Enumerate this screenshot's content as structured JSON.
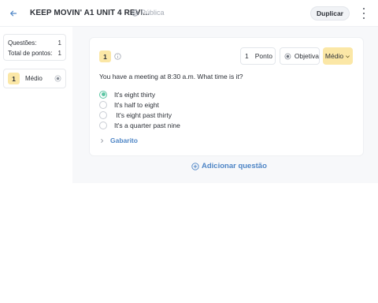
{
  "header": {
    "title": "KEEP MOVIN' A1 UNIT 4 REVI...",
    "visibility": "Pública",
    "duplicate_label": "Duplicar"
  },
  "summary": {
    "questions_label": "Questões:",
    "questions_value": "1",
    "points_label": "Total de pontos:",
    "points_value": "1"
  },
  "sidebar": {
    "question_number": "1",
    "question_difficulty": "Médio"
  },
  "question": {
    "number": "1",
    "points_value": "1",
    "points_label": "Ponto",
    "type_label": "Objetiva",
    "difficulty_label": "Médio",
    "prompt": "You have a meeting at 8:30 a.m. What time is it?",
    "options": [
      {
        "text": "It's eight thirty",
        "selected": true
      },
      {
        "text": "It's half to eight",
        "selected": false
      },
      {
        "text": " It's eight past thirty",
        "selected": false
      },
      {
        "text": "It's a quarter past nine",
        "selected": false
      }
    ],
    "answer_key_label": "Gabarito"
  },
  "add_question_label": "Adicionar questão",
  "colors": {
    "accent_blue": "#4f86c6",
    "difficulty_yellow": "#fbe7a6",
    "selected_green": "#5dc6a4"
  },
  "icons": {
    "back": "arrow-left-icon",
    "visibility": "globe-icon",
    "menu": "kebab-icon",
    "info": "info-icon",
    "type": "radio-icon",
    "dropdown": "chevron-down-icon",
    "expand": "chevron-right-icon",
    "add": "plus-circle-icon"
  }
}
